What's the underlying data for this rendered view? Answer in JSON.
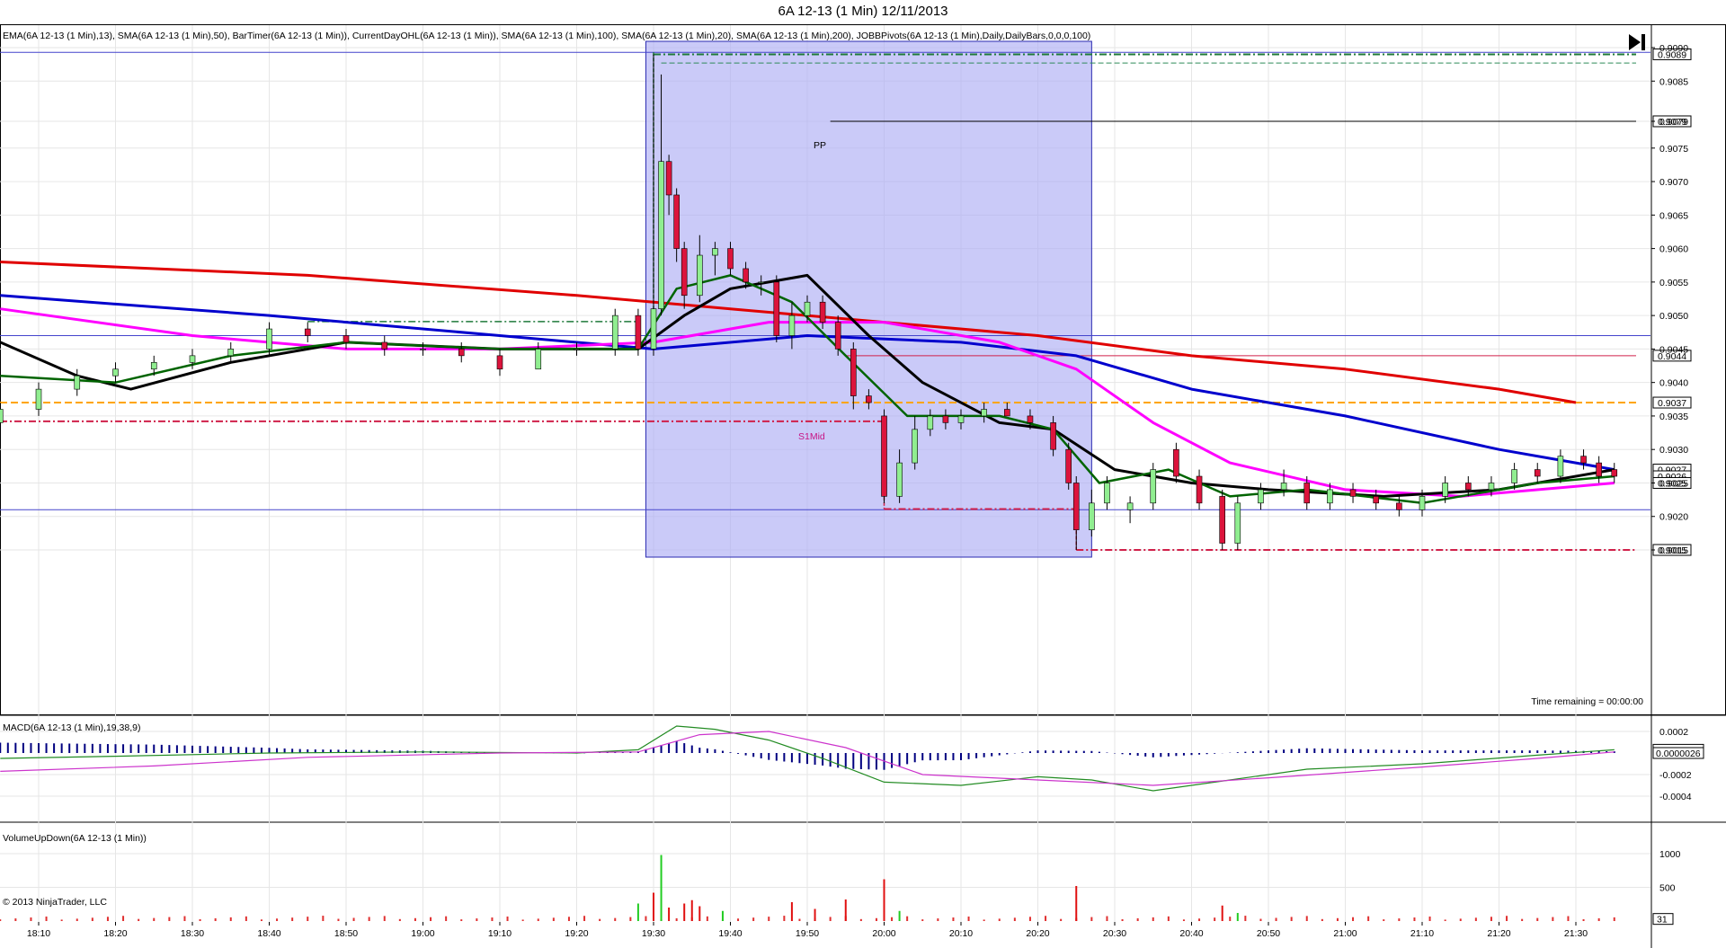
{
  "title": "6A 12-13 (1 Min)  12/11/2013",
  "copyright": "© 2013 NinjaTrader, LLC",
  "time_remaining": "Time remaining = 00:00:00",
  "indicators_label": "EMA(6A 12-13 (1 Min),13), SMA(6A 12-13 (1 Min),50), BarTimer(6A 12-13 (1 Min)), CurrentDayOHL(6A 12-13 (1 Min)), SMA(6A 12-13 (1 Min),100), SMA(6A 12-13 (1 Min),20), SMA(6A 12-13 (1 Min),200), JOBBPivots(6A 12-13 (1 Min),Daily,DailyBars,0,0,0,100)",
  "macd_label": "MACD(6A 12-13 (1 Min),19,38,9)",
  "volume_label": "VolumeUpDown(6A 12-13 (1 Min))",
  "pivot_labels": {
    "pp": "PP",
    "s1mid": "S1Mid"
  },
  "colors": {
    "up": "#90EE90",
    "down": "#DC143C",
    "ema13": "#000000",
    "sma20": "#006400",
    "sma50": "#FF00FF",
    "sma100": "#0000CD",
    "sma200": "#E00000",
    "highlight": "#AEAEF5",
    "macd": "#228B22",
    "macd_avg": "#CC33CC",
    "macd_hist": "#000080"
  },
  "chart_data": {
    "type": "candlestick",
    "x_ticks": [
      "18:10",
      "18:20",
      "18:30",
      "18:40",
      "18:50",
      "19:00",
      "19:10",
      "19:20",
      "19:30",
      "19:40",
      "19:50",
      "20:00",
      "20:10",
      "20:20",
      "20:30",
      "20:40",
      "20:50",
      "21:00",
      "21:10",
      "21:20",
      "21:30"
    ],
    "y_ticks": [
      "0.9090",
      "0.9085",
      "0.9079",
      "0.9075",
      "0.9070",
      "0.9065",
      "0.9060",
      "0.9055",
      "0.9050",
      "0.9045",
      "0.9040",
      "0.9035",
      "0.9030",
      "0.9025",
      "0.9020",
      "0.9015"
    ],
    "ylim": [
      0.9011,
      0.9091
    ],
    "price_tags": [
      {
        "label": "0.9089",
        "value": 0.9089
      },
      {
        "label": "0.9079",
        "value": 0.9079
      },
      {
        "label": "0.9044",
        "value": 0.9044
      },
      {
        "label": "0.9037",
        "value": 0.9037
      },
      {
        "label": "0.9027",
        "value": 0.9027
      },
      {
        "label": "0.9026",
        "value": 0.9026
      },
      {
        "label": "0.9025",
        "value": 0.9025
      },
      {
        "label": "0.9015",
        "value": 0.9015
      }
    ],
    "levels": {
      "current_day_high": 0.9089,
      "current_day_low": 0.9015,
      "open": 0.9037,
      "pp": 0.9079,
      "s1mid": 0.9044,
      "upper_line": 0.9047,
      "lower_line": 0.9021
    },
    "highlight_window": [
      "19:29",
      "20:27"
    ],
    "candles": [
      {
        "t": "18:05",
        "o": 0.9034,
        "h": 0.9037,
        "l": 0.9034,
        "c": 0.9036
      },
      {
        "t": "18:10",
        "o": 0.9036,
        "h": 0.904,
        "l": 0.9035,
        "c": 0.9039
      },
      {
        "t": "18:15",
        "o": 0.9039,
        "h": 0.9042,
        "l": 0.9038,
        "c": 0.9041
      },
      {
        "t": "18:20",
        "o": 0.9041,
        "h": 0.9043,
        "l": 0.904,
        "c": 0.9042
      },
      {
        "t": "18:25",
        "o": 0.9042,
        "h": 0.9044,
        "l": 0.9041,
        "c": 0.9043
      },
      {
        "t": "18:30",
        "o": 0.9043,
        "h": 0.9045,
        "l": 0.9042,
        "c": 0.9044
      },
      {
        "t": "18:35",
        "o": 0.9044,
        "h": 0.9046,
        "l": 0.9043,
        "c": 0.9045
      },
      {
        "t": "18:40",
        "o": 0.9045,
        "h": 0.9049,
        "l": 0.9044,
        "c": 0.9048
      },
      {
        "t": "18:45",
        "o": 0.9048,
        "h": 0.9049,
        "l": 0.9046,
        "c": 0.9047
      },
      {
        "t": "18:50",
        "o": 0.9047,
        "h": 0.9048,
        "l": 0.9045,
        "c": 0.9046
      },
      {
        "t": "18:55",
        "o": 0.9046,
        "h": 0.9047,
        "l": 0.9044,
        "c": 0.9045
      },
      {
        "t": "19:00",
        "o": 0.9045,
        "h": 0.9046,
        "l": 0.9044,
        "c": 0.9045
      },
      {
        "t": "19:05",
        "o": 0.9045,
        "h": 0.9046,
        "l": 0.9043,
        "c": 0.9044
      },
      {
        "t": "19:10",
        "o": 0.9044,
        "h": 0.9045,
        "l": 0.9041,
        "c": 0.9042
      },
      {
        "t": "19:15",
        "o": 0.9042,
        "h": 0.9046,
        "l": 0.9042,
        "c": 0.9045
      },
      {
        "t": "19:20",
        "o": 0.9045,
        "h": 0.9046,
        "l": 0.9044,
        "c": 0.9045
      },
      {
        "t": "19:25",
        "o": 0.9045,
        "h": 0.9051,
        "l": 0.9044,
        "c": 0.905
      },
      {
        "t": "19:28",
        "o": 0.905,
        "h": 0.9051,
        "l": 0.9044,
        "c": 0.9045
      },
      {
        "t": "19:30",
        "o": 0.9045,
        "h": 0.9089,
        "l": 0.9044,
        "c": 0.9051
      },
      {
        "t": "19:31",
        "o": 0.9051,
        "h": 0.9086,
        "l": 0.905,
        "c": 0.9073
      },
      {
        "t": "19:32",
        "o": 0.9073,
        "h": 0.9074,
        "l": 0.9065,
        "c": 0.9068
      },
      {
        "t": "19:33",
        "o": 0.9068,
        "h": 0.9069,
        "l": 0.9058,
        "c": 0.906
      },
      {
        "t": "19:34",
        "o": 0.906,
        "h": 0.9061,
        "l": 0.9051,
        "c": 0.9053
      },
      {
        "t": "19:36",
        "o": 0.9053,
        "h": 0.9062,
        "l": 0.9052,
        "c": 0.9059
      },
      {
        "t": "19:38",
        "o": 0.9059,
        "h": 0.9061,
        "l": 0.9056,
        "c": 0.906
      },
      {
        "t": "19:40",
        "o": 0.906,
        "h": 0.9061,
        "l": 0.9056,
        "c": 0.9057
      },
      {
        "t": "19:42",
        "o": 0.9057,
        "h": 0.9058,
        "l": 0.9054,
        "c": 0.9055
      },
      {
        "t": "19:44",
        "o": 0.9055,
        "h": 0.9056,
        "l": 0.9053,
        "c": 0.9055
      },
      {
        "t": "19:46",
        "o": 0.9055,
        "h": 0.9056,
        "l": 0.9046,
        "c": 0.9047
      },
      {
        "t": "19:48",
        "o": 0.9047,
        "h": 0.9052,
        "l": 0.9045,
        "c": 0.905
      },
      {
        "t": "19:50",
        "o": 0.905,
        "h": 0.9053,
        "l": 0.9049,
        "c": 0.9052
      },
      {
        "t": "19:52",
        "o": 0.9052,
        "h": 0.9053,
        "l": 0.9048,
        "c": 0.9049
      },
      {
        "t": "19:54",
        "o": 0.9049,
        "h": 0.905,
        "l": 0.9044,
        "c": 0.9045
      },
      {
        "t": "19:56",
        "o": 0.9045,
        "h": 0.9046,
        "l": 0.9036,
        "c": 0.9038
      },
      {
        "t": "19:58",
        "o": 0.9038,
        "h": 0.9039,
        "l": 0.9036,
        "c": 0.9037
      },
      {
        "t": "20:00",
        "o": 0.9035,
        "h": 0.9036,
        "l": 0.9022,
        "c": 0.9023
      },
      {
        "t": "20:02",
        "o": 0.9023,
        "h": 0.903,
        "l": 0.9022,
        "c": 0.9028
      },
      {
        "t": "20:04",
        "o": 0.9028,
        "h": 0.9035,
        "l": 0.9027,
        "c": 0.9033
      },
      {
        "t": "20:06",
        "o": 0.9033,
        "h": 0.9036,
        "l": 0.9032,
        "c": 0.9035
      },
      {
        "t": "20:08",
        "o": 0.9035,
        "h": 0.9036,
        "l": 0.9033,
        "c": 0.9034
      },
      {
        "t": "20:10",
        "o": 0.9034,
        "h": 0.9036,
        "l": 0.9033,
        "c": 0.9035
      },
      {
        "t": "20:13",
        "o": 0.9035,
        "h": 0.9037,
        "l": 0.9034,
        "c": 0.9036
      },
      {
        "t": "20:16",
        "o": 0.9036,
        "h": 0.9037,
        "l": 0.9035,
        "c": 0.9035
      },
      {
        "t": "20:19",
        "o": 0.9035,
        "h": 0.9036,
        "l": 0.9033,
        "c": 0.9034
      },
      {
        "t": "20:22",
        "o": 0.9034,
        "h": 0.9035,
        "l": 0.9029,
        "c": 0.903
      },
      {
        "t": "20:24",
        "o": 0.903,
        "h": 0.9031,
        "l": 0.9024,
        "c": 0.9025
      },
      {
        "t": "20:25",
        "o": 0.9025,
        "h": 0.9026,
        "l": 0.9015,
        "c": 0.9018
      },
      {
        "t": "20:27",
        "o": 0.9018,
        "h": 0.9024,
        "l": 0.9017,
        "c": 0.9022
      },
      {
        "t": "20:29",
        "o": 0.9022,
        "h": 0.9026,
        "l": 0.9021,
        "c": 0.9025
      },
      {
        "t": "20:32",
        "o": 0.9021,
        "h": 0.9023,
        "l": 0.9019,
        "c": 0.9022
      },
      {
        "t": "20:35",
        "o": 0.9022,
        "h": 0.9028,
        "l": 0.9021,
        "c": 0.9027
      },
      {
        "t": "20:38",
        "o": 0.903,
        "h": 0.9031,
        "l": 0.9025,
        "c": 0.9026
      },
      {
        "t": "20:41",
        "o": 0.9026,
        "h": 0.9027,
        "l": 0.9021,
        "c": 0.9022
      },
      {
        "t": "20:44",
        "o": 0.9023,
        "h": 0.9024,
        "l": 0.9015,
        "c": 0.9016
      },
      {
        "t": "20:46",
        "o": 0.9016,
        "h": 0.9023,
        "l": 0.9015,
        "c": 0.9022
      },
      {
        "t": "20:49",
        "o": 0.9022,
        "h": 0.9025,
        "l": 0.9021,
        "c": 0.9024
      },
      {
        "t": "20:52",
        "o": 0.9024,
        "h": 0.9027,
        "l": 0.9023,
        "c": 0.9025
      },
      {
        "t": "20:55",
        "o": 0.9025,
        "h": 0.9026,
        "l": 0.9021,
        "c": 0.9022
      },
      {
        "t": "20:58",
        "o": 0.9022,
        "h": 0.9025,
        "l": 0.9021,
        "c": 0.9024
      },
      {
        "t": "21:01",
        "o": 0.9024,
        "h": 0.9025,
        "l": 0.9022,
        "c": 0.9023
      },
      {
        "t": "21:04",
        "o": 0.9023,
        "h": 0.9024,
        "l": 0.9021,
        "c": 0.9022
      },
      {
        "t": "21:07",
        "o": 0.9022,
        "h": 0.9023,
        "l": 0.902,
        "c": 0.9021
      },
      {
        "t": "21:10",
        "o": 0.9021,
        "h": 0.9024,
        "l": 0.902,
        "c": 0.9023
      },
      {
        "t": "21:13",
        "o": 0.9023,
        "h": 0.9026,
        "l": 0.9022,
        "c": 0.9025
      },
      {
        "t": "21:16",
        "o": 0.9025,
        "h": 0.9026,
        "l": 0.9023,
        "c": 0.9024
      },
      {
        "t": "21:19",
        "o": 0.9024,
        "h": 0.9026,
        "l": 0.9023,
        "c": 0.9025
      },
      {
        "t": "21:22",
        "o": 0.9025,
        "h": 0.9028,
        "l": 0.9024,
        "c": 0.9027
      },
      {
        "t": "21:25",
        "o": 0.9027,
        "h": 0.9028,
        "l": 0.9025,
        "c": 0.9026
      },
      {
        "t": "21:28",
        "o": 0.9026,
        "h": 0.903,
        "l": 0.9025,
        "c": 0.9029
      },
      {
        "t": "21:31",
        "o": 0.9029,
        "h": 0.903,
        "l": 0.9027,
        "c": 0.9028
      },
      {
        "t": "21:33",
        "o": 0.9028,
        "h": 0.9029,
        "l": 0.9025,
        "c": 0.9026
      },
      {
        "t": "21:35",
        "o": 0.9027,
        "h": 0.9028,
        "l": 0.9025,
        "c": 0.9026
      }
    ],
    "sma200": [
      [
        "18:05",
        0.9058
      ],
      [
        "18:45",
        0.9056
      ],
      [
        "19:20",
        0.9053
      ],
      [
        "19:40",
        0.9051
      ],
      [
        "20:00",
        0.9049
      ],
      [
        "20:20",
        0.9047
      ],
      [
        "20:40",
        0.9044
      ],
      [
        "21:00",
        0.9042
      ],
      [
        "21:20",
        0.9039
      ],
      [
        "21:30",
        0.9037
      ]
    ],
    "sma100": [
      [
        "18:05",
        0.9053
      ],
      [
        "18:40",
        0.905
      ],
      [
        "19:10",
        0.9047
      ],
      [
        "19:30",
        0.9045
      ],
      [
        "19:50",
        0.9047
      ],
      [
        "20:10",
        0.9046
      ],
      [
        "20:25",
        0.9044
      ],
      [
        "20:40",
        0.9039
      ],
      [
        "21:00",
        0.9035
      ],
      [
        "21:20",
        0.903
      ],
      [
        "21:35",
        0.9027
      ]
    ],
    "sma50": [
      [
        "18:05",
        0.9051
      ],
      [
        "18:30",
        0.9047
      ],
      [
        "18:50",
        0.9045
      ],
      [
        "19:10",
        0.9045
      ],
      [
        "19:30",
        0.9046
      ],
      [
        "19:45",
        0.9049
      ],
      [
        "20:00",
        0.9049
      ],
      [
        "20:15",
        0.9046
      ],
      [
        "20:25",
        0.9042
      ],
      [
        "20:35",
        0.9034
      ],
      [
        "20:45",
        0.9028
      ],
      [
        "21:00",
        0.9024
      ],
      [
        "21:15",
        0.9023
      ],
      [
        "21:35",
        0.9025
      ]
    ],
    "ema13": [
      [
        "18:05",
        0.9046
      ],
      [
        "18:15",
        0.9041
      ],
      [
        "18:22",
        0.9039
      ],
      [
        "18:35",
        0.9043
      ],
      [
        "18:50",
        0.9046
      ],
      [
        "19:10",
        0.9045
      ],
      [
        "19:28",
        0.9045
      ],
      [
        "19:34",
        0.905
      ],
      [
        "19:40",
        0.9054
      ],
      [
        "19:50",
        0.9056
      ],
      [
        "19:58",
        0.9047
      ],
      [
        "20:05",
        0.904
      ],
      [
        "20:15",
        0.9034
      ],
      [
        "20:22",
        0.9033
      ],
      [
        "20:30",
        0.9027
      ],
      [
        "20:40",
        0.9025
      ],
      [
        "20:50",
        0.9024
      ],
      [
        "21:05",
        0.9023
      ],
      [
        "21:20",
        0.9024
      ],
      [
        "21:35",
        0.9027
      ]
    ],
    "sma20": [
      [
        "18:05",
        0.9041
      ],
      [
        "18:20",
        0.904
      ],
      [
        "18:35",
        0.9044
      ],
      [
        "18:50",
        0.9046
      ],
      [
        "19:10",
        0.9045
      ],
      [
        "19:28",
        0.9045
      ],
      [
        "19:33",
        0.9054
      ],
      [
        "19:40",
        0.9056
      ],
      [
        "19:48",
        0.9052
      ],
      [
        "19:55",
        0.9044
      ],
      [
        "20:03",
        0.9035
      ],
      [
        "20:15",
        0.9035
      ],
      [
        "20:22",
        0.9033
      ],
      [
        "20:28",
        0.9025
      ],
      [
        "20:37",
        0.9027
      ],
      [
        "20:45",
        0.9023
      ],
      [
        "20:55",
        0.9024
      ],
      [
        "21:10",
        0.9022
      ],
      [
        "21:25",
        0.9025
      ],
      [
        "21:35",
        0.9026
      ]
    ],
    "macd": {
      "y_ticks": [
        "0.0002",
        "-0.0002",
        "-0.0004"
      ],
      "ylim": [
        -0.00045,
        0.0003
      ]
    },
    "volume": {
      "y_ticks": [
        "1000",
        "500",
        "31"
      ],
      "ylim": [
        0,
        1100
      ]
    }
  }
}
